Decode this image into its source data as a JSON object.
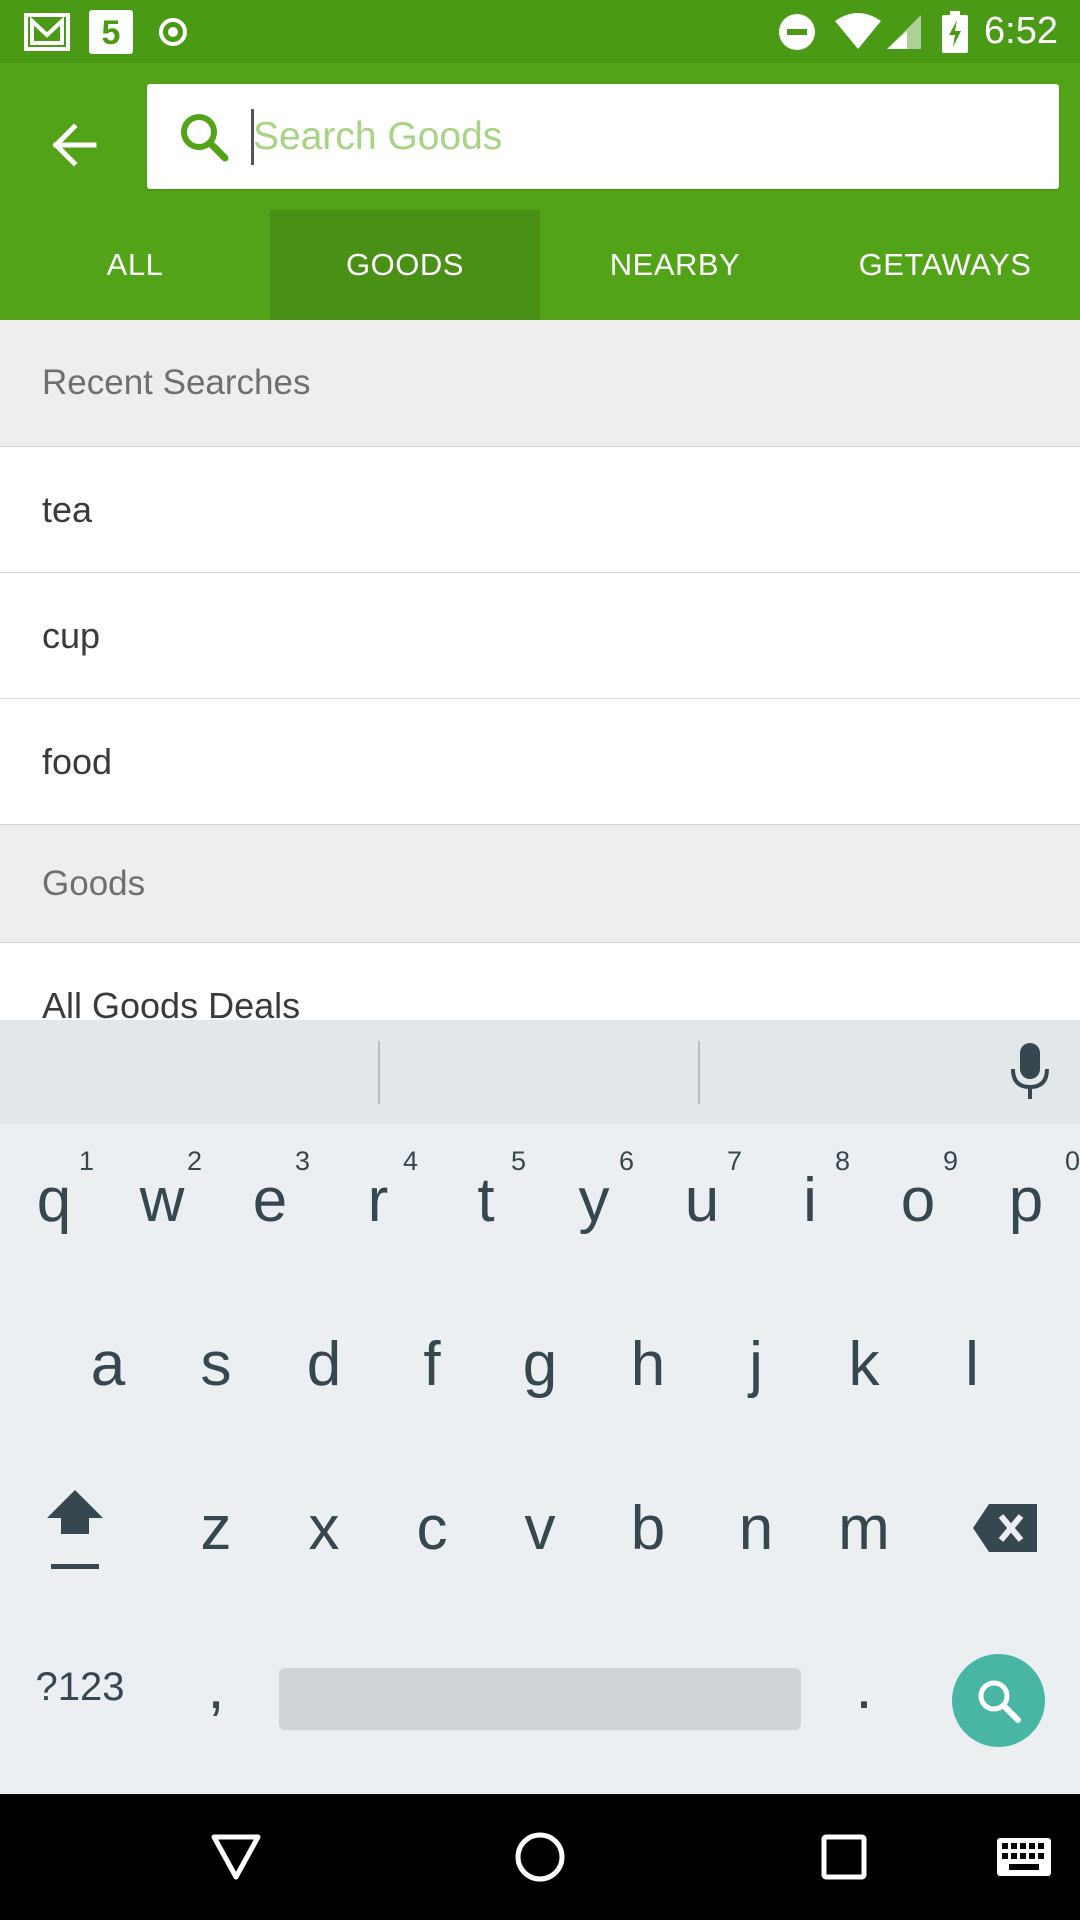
{
  "status_bar": {
    "time": "6:52",
    "icons": [
      "gmail-icon",
      "channel5-icon",
      "record-icon",
      "dnd-icon",
      "wifi-icon",
      "signal-icon",
      "battery-charging-icon"
    ]
  },
  "search": {
    "placeholder": "Search Goods",
    "value": ""
  },
  "tabs": [
    {
      "label": "ALL",
      "active": false
    },
    {
      "label": "GOODS",
      "active": true
    },
    {
      "label": "NEARBY",
      "active": false
    },
    {
      "label": "GETAWAYS",
      "active": false
    }
  ],
  "recent": {
    "header": "Recent Searches",
    "items": [
      "tea",
      "cup",
      "food"
    ]
  },
  "goods": {
    "header": "Goods",
    "items": [
      "All Goods Deals"
    ]
  },
  "keyboard": {
    "row1": [
      {
        "key": "q",
        "hint": "1"
      },
      {
        "key": "w",
        "hint": "2"
      },
      {
        "key": "e",
        "hint": "3"
      },
      {
        "key": "r",
        "hint": "4"
      },
      {
        "key": "t",
        "hint": "5"
      },
      {
        "key": "y",
        "hint": "6"
      },
      {
        "key": "u",
        "hint": "7"
      },
      {
        "key": "i",
        "hint": "8"
      },
      {
        "key": "o",
        "hint": "9"
      },
      {
        "key": "p",
        "hint": "0"
      }
    ],
    "row2": [
      "a",
      "s",
      "d",
      "f",
      "g",
      "h",
      "j",
      "k",
      "l"
    ],
    "row3": [
      "z",
      "x",
      "c",
      "v",
      "b",
      "n",
      "m"
    ],
    "symbols_label": "?123",
    "comma": ",",
    "period": "."
  },
  "colors": {
    "status_bar": "#4a9a16",
    "app_bar": "#53a318",
    "active_tab": "#4a9016",
    "search_action": "#48b5a5"
  }
}
